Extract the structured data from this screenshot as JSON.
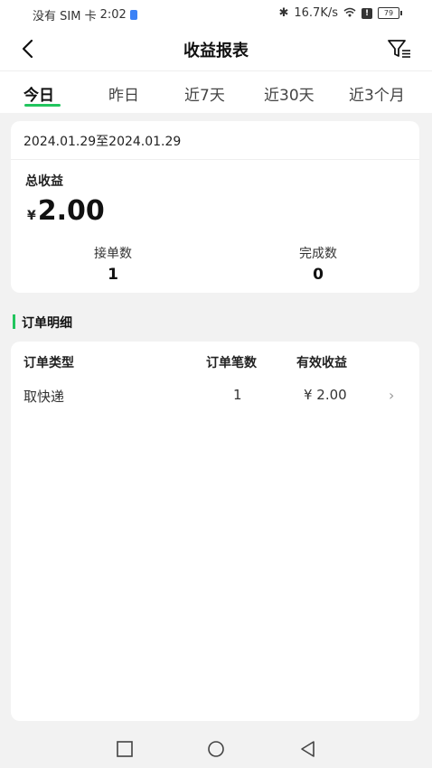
{
  "status_bar": {
    "carrier": "没有 SIM 卡",
    "time": "2:02",
    "bluetooth": "✱",
    "speed": "16.7K/s",
    "battery": "79"
  },
  "header": {
    "title": "收益报表",
    "back_icon": "chevron-left-icon",
    "filter_icon": "filter-icon"
  },
  "tabs": [
    {
      "label": "今日",
      "active": true
    },
    {
      "label": "昨日",
      "active": false
    },
    {
      "label": "近7天",
      "active": false
    },
    {
      "label": "近30天",
      "active": false
    },
    {
      "label": "近3个月",
      "active": false
    }
  ],
  "summary": {
    "date_range": "2024.01.29至2024.01.29",
    "total_label": "总收益",
    "currency": "¥",
    "total_value": "2.00",
    "accepted_label": "接单数",
    "accepted_value": "1",
    "completed_label": "完成数",
    "completed_value": "0"
  },
  "detail": {
    "section_title": "订单明细",
    "columns": [
      "订单类型",
      "订单笔数",
      "有效收益"
    ],
    "rows": [
      {
        "type": "取快递",
        "count": "1",
        "income": "¥ 2.00"
      }
    ],
    "chevron": "›"
  },
  "colors": {
    "accent": "#22c55e",
    "background": "#f2f2f2",
    "card": "#ffffff"
  }
}
